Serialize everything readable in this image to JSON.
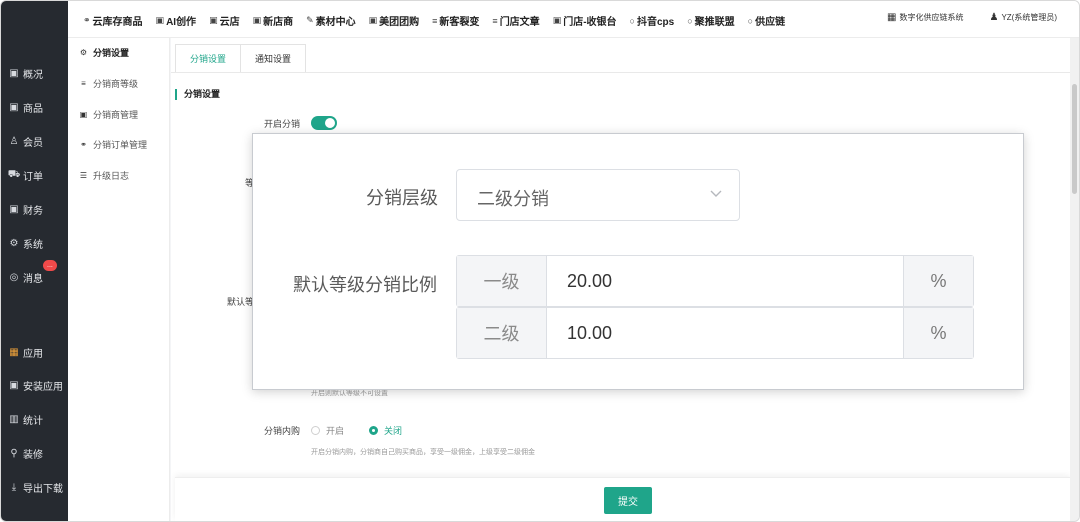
{
  "sidebar": {
    "items": [
      {
        "icon": "chart-icon",
        "glyph": "▣",
        "label": "概况"
      },
      {
        "icon": "goods-icon",
        "glyph": "▣",
        "label": "商品"
      },
      {
        "icon": "member-icon",
        "glyph": "♙",
        "label": "会员"
      },
      {
        "icon": "cart-icon",
        "glyph": "⛟",
        "label": "订单"
      },
      {
        "icon": "finance-icon",
        "glyph": "▣",
        "label": "财务"
      },
      {
        "icon": "gear-icon",
        "glyph": "⚙",
        "label": "系统"
      },
      {
        "icon": "message-icon",
        "glyph": "◎",
        "label": "消息",
        "badge": "..."
      },
      {
        "icon": "apps-icon",
        "glyph": "▦",
        "label": "应用"
      },
      {
        "icon": "install-icon",
        "glyph": "▣",
        "label": "安装应用"
      },
      {
        "icon": "stats-icon",
        "glyph": "▥",
        "label": "统计"
      },
      {
        "icon": "decorate-icon",
        "glyph": "⚲",
        "label": "装修"
      },
      {
        "icon": "download-icon",
        "glyph": "⤓",
        "label": "导出下载"
      }
    ]
  },
  "topnav": {
    "items": [
      {
        "icon": "link-icon",
        "glyph": "⚭",
        "label": "云库存商品"
      },
      {
        "icon": "ai-icon",
        "glyph": "▣",
        "label": "AI创作"
      },
      {
        "icon": "image-icon",
        "glyph": "▣",
        "label": "云店"
      },
      {
        "icon": "store-icon",
        "glyph": "▣",
        "label": "新店商"
      },
      {
        "icon": "material-icon",
        "glyph": "✎",
        "label": "素材中心"
      },
      {
        "icon": "group-buy-icon",
        "glyph": "▣",
        "label": "美团团购"
      },
      {
        "icon": "list-icon",
        "glyph": "≡",
        "label": "新客裂变"
      },
      {
        "icon": "list-icon",
        "glyph": "≡",
        "label": "门店文章"
      },
      {
        "icon": "cashier-icon",
        "glyph": "▣",
        "label": "门店-收银台"
      },
      {
        "icon": "circle-icon",
        "glyph": "○",
        "label": "抖音cps"
      },
      {
        "icon": "circle-icon",
        "glyph": "○",
        "label": "聚推联盟"
      },
      {
        "icon": "circle-icon",
        "glyph": "○",
        "label": "供应链"
      }
    ],
    "system": {
      "glyph": "▦",
      "label": "数字化供应链系统"
    },
    "user": {
      "glyph": "♟",
      "label": "YZ(系统管理员)"
    }
  },
  "submenu": {
    "items": [
      {
        "icon": "gear-icon",
        "glyph": "⚙",
        "label": "分销设置",
        "active": true
      },
      {
        "icon": "sliders-icon",
        "glyph": "≡",
        "label": "分销商等级"
      },
      {
        "icon": "user-manage-icon",
        "glyph": "▣",
        "label": "分销商管理"
      },
      {
        "icon": "order-icon",
        "glyph": "⚭",
        "label": "分销订单管理"
      },
      {
        "icon": "log-icon",
        "glyph": "☰",
        "label": "升级日志"
      }
    ]
  },
  "main": {
    "tabs": [
      {
        "label": "分销设置",
        "active": true
      },
      {
        "label": "通知设置"
      }
    ],
    "section_title": "分销设置",
    "enable_label": "开启分销",
    "enable_on": true,
    "partial_label_level": "等",
    "partial_label_default": "默认等",
    "hint_default_level": "开启则默认等级不可设置",
    "self_purchase_label": "分销内购",
    "self_purchase_options": [
      {
        "label": "开启",
        "checked": false
      },
      {
        "label": "关闭",
        "checked": true
      }
    ],
    "self_purchase_hint": "开启分销内购，分销商自己购买商品，享受一级佣金，上级享受二级佣金",
    "submit_label": "提交"
  },
  "overlay": {
    "level_label": "分销层级",
    "level_value": "二级分销",
    "ratio_label": "默认等级分销比例",
    "ratios": [
      {
        "prefix": "一级",
        "value": "20.00",
        "suffix": "%"
      },
      {
        "prefix": "二级",
        "value": "10.00",
        "suffix": "%"
      }
    ]
  },
  "colors": {
    "accent": "#1fa58a",
    "sidebar": "#262a30",
    "badge": "#f04a4a"
  }
}
